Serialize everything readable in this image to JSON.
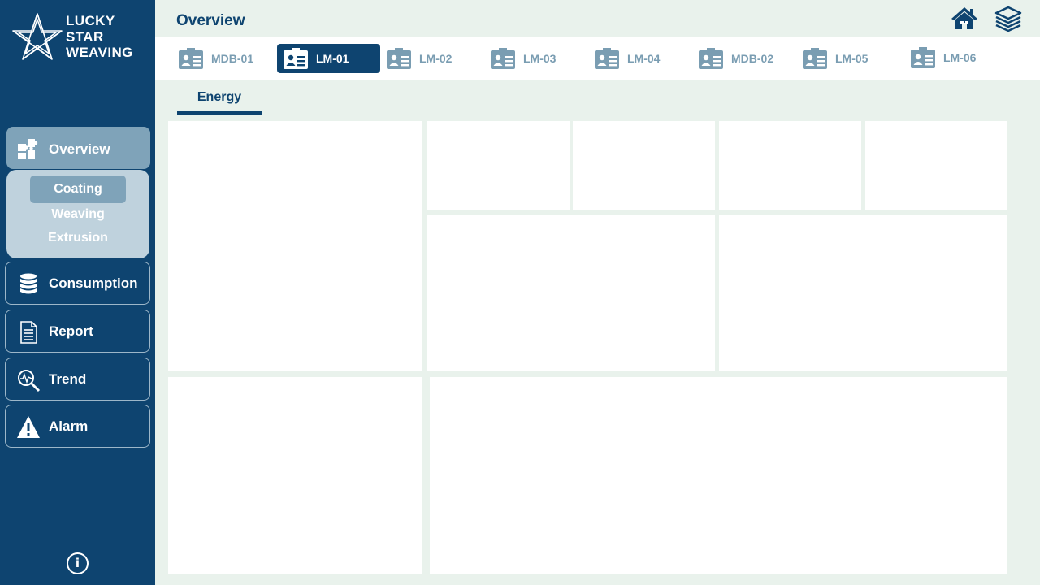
{
  "brand": {
    "line1": "LUCKY",
    "line2": "STAR",
    "line3": "WEAVING"
  },
  "header": {
    "title": "Overview",
    "icons": [
      "home-icon",
      "layers-stack-icon"
    ]
  },
  "sidebar": {
    "overview_label": "Overview",
    "overview_subitems": [
      {
        "label": "Coating",
        "active": true
      },
      {
        "label": "Weaving",
        "active": false
      },
      {
        "label": "Extrusion",
        "active": false
      }
    ],
    "items": [
      {
        "label": "Consumption",
        "icon": "database-icon"
      },
      {
        "label": "Report",
        "icon": "document-icon"
      },
      {
        "label": "Trend",
        "icon": "trend-magnifier-icon"
      },
      {
        "label": "Alarm",
        "icon": "warning-icon"
      }
    ],
    "info_glyph": "i"
  },
  "meter_tabs": [
    {
      "label": "MDB-01",
      "active": false
    },
    {
      "label": "LM-01",
      "active": true
    },
    {
      "label": "LM-02",
      "active": false
    },
    {
      "label": "LM-03",
      "active": false
    },
    {
      "label": "LM-04",
      "active": false
    },
    {
      "label": "MDB-02",
      "active": false
    },
    {
      "label": "LM-05",
      "active": false
    },
    {
      "label": "LM-06",
      "active": false
    }
  ],
  "sub_tabs": [
    {
      "label": "Energy",
      "active": true
    }
  ],
  "colors": {
    "navy": "#0e4470",
    "accent_muted": "#7fa3b9",
    "subpanel": "#bfd2dd",
    "background": "#e9f2ec"
  }
}
